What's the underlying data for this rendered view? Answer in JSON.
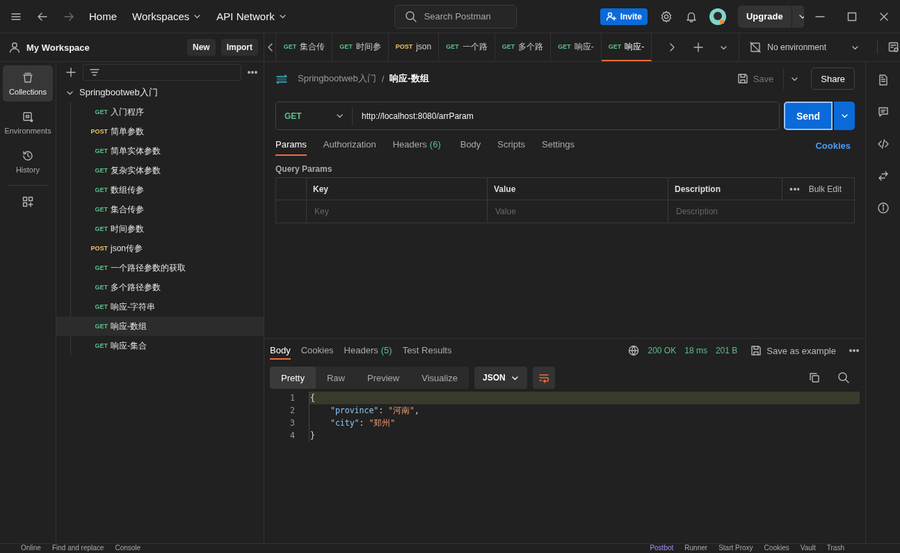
{
  "header": {
    "nav": [
      {
        "label": "Home",
        "caret": false
      },
      {
        "label": "Workspaces",
        "caret": true
      },
      {
        "label": "API Network",
        "caret": true
      }
    ],
    "search": {
      "placeholder": "Search Postman"
    },
    "invite": "Invite",
    "upgrade": "Upgrade"
  },
  "workspace": {
    "title": "My Workspace",
    "buttons": [
      "New",
      "Import"
    ]
  },
  "rail": [
    {
      "label": "Collections",
      "selected": true
    },
    {
      "label": "Environments",
      "selected": false
    },
    {
      "label": "History",
      "selected": false
    }
  ],
  "collection": {
    "name": "Springbootweb入门",
    "expanded": true,
    "children": [
      {
        "method": "GET",
        "color": "#5cc08a",
        "name": "入门程序",
        "selected": false
      },
      {
        "method": "POST",
        "color": "#e9c46a",
        "name": "简单参数",
        "selected": false
      },
      {
        "method": "GET",
        "color": "#5cc08a",
        "name": "简单实体参数",
        "selected": false
      },
      {
        "method": "GET",
        "color": "#5cc08a",
        "name": "复杂实体参数",
        "selected": false
      },
      {
        "method": "GET",
        "color": "#5cc08a",
        "name": "数组传参",
        "selected": false
      },
      {
        "method": "GET",
        "color": "#5cc08a",
        "name": "集合传参",
        "selected": false
      },
      {
        "method": "GET",
        "color": "#5cc08a",
        "name": "时间参数",
        "selected": false
      },
      {
        "method": "POST",
        "color": "#e9c46a",
        "name": "json传参",
        "selected": false
      },
      {
        "method": "GET",
        "color": "#5cc08a",
        "name": "一个路径参数的获取",
        "selected": false
      },
      {
        "method": "GET",
        "color": "#5cc08a",
        "name": "多个路径参数",
        "selected": false
      },
      {
        "method": "GET",
        "color": "#5cc08a",
        "name": "响应-字符串",
        "selected": false
      },
      {
        "method": "GET",
        "color": "#5cc08a",
        "name": "响应-数组",
        "selected": true
      },
      {
        "method": "GET",
        "color": "#5cc08a",
        "name": "响应-集合",
        "selected": false
      }
    ]
  },
  "tabs": [
    {
      "method": "GET",
      "color": "#5cc08a",
      "label": "集合传",
      "selected": false
    },
    {
      "method": "GET",
      "color": "#5cc08a",
      "label": "时间参",
      "selected": false
    },
    {
      "method": "POST",
      "color": "#e9c46a",
      "label": "json",
      "selected": false
    },
    {
      "method": "GET",
      "color": "#5cc08a",
      "label": "一个路",
      "selected": false
    },
    {
      "method": "GET",
      "color": "#5cc08a",
      "label": "多个路",
      "selected": false
    },
    {
      "method": "GET",
      "color": "#5cc08a",
      "label": "响应-",
      "selected": false
    },
    {
      "method": "GET",
      "color": "#5cc08a",
      "label": "响应-",
      "selected": true
    }
  ],
  "environment": "No environment",
  "request": {
    "breadcrumb": {
      "parent": "Springbootweb入门",
      "separator": "/",
      "current": "响应-数组"
    },
    "save": "Save",
    "share": "Share",
    "method": "GET",
    "url": "http://localhost:8080/arrParam",
    "send": "Send",
    "tabs": [
      {
        "label": "Params",
        "selected": true
      },
      {
        "label": "Authorization",
        "selected": false
      },
      {
        "label": "Headers",
        "count": "(6)",
        "selected": false
      },
      {
        "label": "Body",
        "selected": false
      },
      {
        "label": "Scripts",
        "selected": false
      },
      {
        "label": "Settings",
        "selected": false
      }
    ],
    "cookies": "Cookies",
    "section": "Query Params",
    "columns": [
      "Key",
      "Value",
      "Description"
    ],
    "bulk_edit": "Bulk Edit",
    "placeholders": [
      "Key",
      "Value",
      "Description"
    ]
  },
  "response": {
    "tabs": [
      {
        "label": "Body",
        "selected": true
      },
      {
        "label": "Cookies",
        "selected": false
      },
      {
        "label": "Headers",
        "count": "(5)",
        "selected": false
      },
      {
        "label": "Test Results",
        "selected": false
      }
    ],
    "status": "200 OK",
    "time": "18 ms",
    "size": "201 B",
    "save_example": "Save as example",
    "views": [
      {
        "label": "Pretty",
        "selected": true
      },
      {
        "label": "Raw",
        "selected": false
      },
      {
        "label": "Preview",
        "selected": false
      },
      {
        "label": "Visualize",
        "selected": false
      }
    ],
    "format": "JSON",
    "lines": [
      {
        "number": "1",
        "highlighted": true,
        "indented": false,
        "tokens": [
          {
            "kind": "punct",
            "text": "{"
          }
        ]
      },
      {
        "number": "2",
        "highlighted": false,
        "indented": true,
        "tokens": [
          {
            "kind": "key",
            "text": "\"province\""
          },
          {
            "kind": "punct",
            "text": ": "
          },
          {
            "kind": "string",
            "text": "\"河南\""
          },
          {
            "kind": "punct",
            "text": ","
          }
        ]
      },
      {
        "number": "3",
        "highlighted": false,
        "indented": true,
        "tokens": [
          {
            "kind": "key",
            "text": "\"city\""
          },
          {
            "kind": "punct",
            "text": ": "
          },
          {
            "kind": "string",
            "text": "\"郑州\""
          }
        ]
      },
      {
        "number": "4",
        "highlighted": false,
        "indented": false,
        "tokens": [
          {
            "kind": "punct",
            "text": "}"
          }
        ]
      }
    ]
  },
  "status_bar": {
    "left": [
      "Online",
      "Find and replace",
      "Console"
    ],
    "right": [
      "Postbot",
      "Runner",
      "Start Proxy",
      "Cookies",
      "Vault",
      "Trash"
    ]
  }
}
